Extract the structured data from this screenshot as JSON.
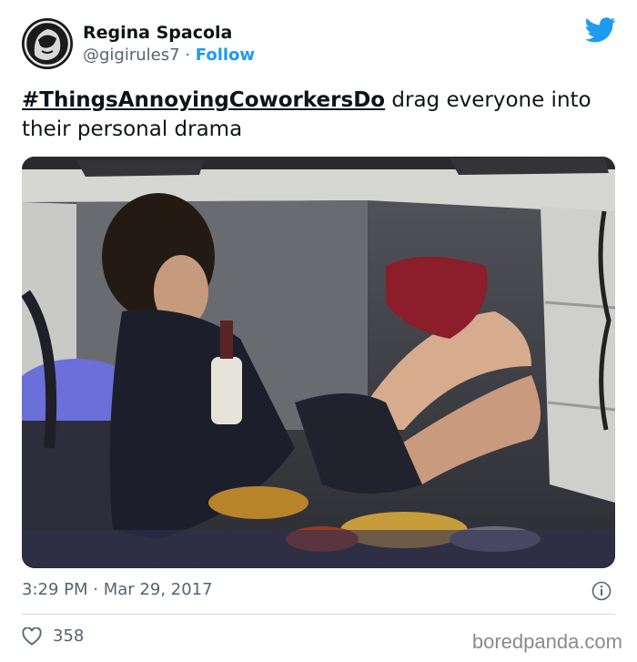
{
  "author": {
    "name": "Regina Spacola",
    "handle": "@gigirules7",
    "separator": "·",
    "follow_label": "Follow",
    "avatar_icon": "avatar-portrait-icon"
  },
  "brand_icon": "twitter-bird-icon",
  "tweet": {
    "hashtag": "#ThingsAnnoyingCoworkersDo",
    "text": " drag everyone into their personal drama"
  },
  "media": {
    "description_icon": "office-desk-photo"
  },
  "meta": {
    "time": "3:29 PM",
    "separator": "·",
    "date": "Mar 29, 2017"
  },
  "engagement": {
    "likes": "358"
  },
  "watermark": "boredpanda.com",
  "colors": {
    "link": "#1d9bf0",
    "text": "#0f1419",
    "muted": "#536471"
  }
}
